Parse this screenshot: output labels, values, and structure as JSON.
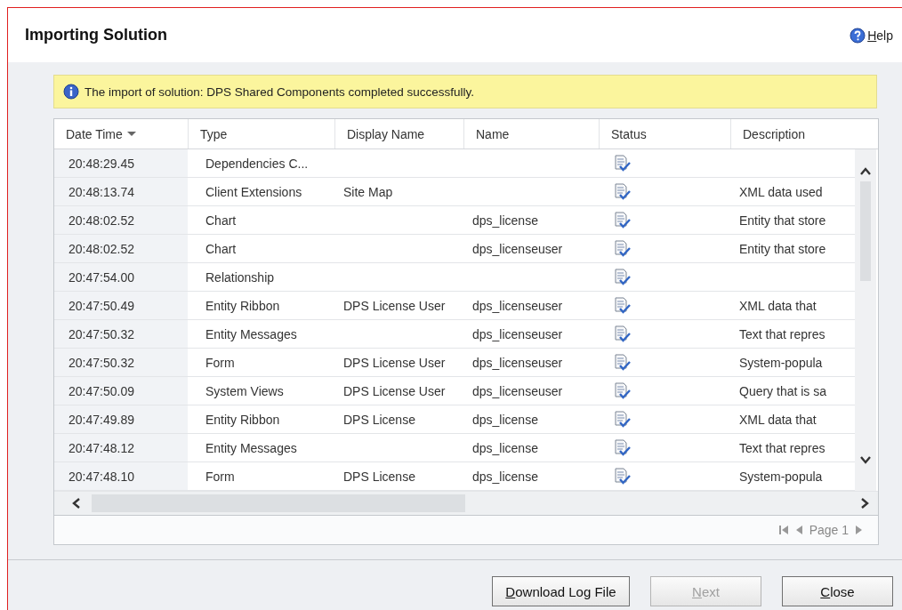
{
  "window": {
    "title": "Importing Solution",
    "help": "Help"
  },
  "banner": {
    "text": "The import of solution: DPS Shared Components completed successfully."
  },
  "table": {
    "columns": [
      {
        "label": "Date Time",
        "sorted": true
      },
      {
        "label": "Type",
        "sorted": false
      },
      {
        "label": "Display Name",
        "sorted": false
      },
      {
        "label": "Name",
        "sorted": false
      },
      {
        "label": "Status",
        "sorted": false
      },
      {
        "label": "Description",
        "sorted": false
      }
    ],
    "rows": [
      {
        "time": "20:48:29.45",
        "type": "Dependencies C...",
        "display_name": "",
        "name": "",
        "completed": true,
        "description": ""
      },
      {
        "time": "20:48:13.74",
        "type": "Client Extensions",
        "display_name": "Site Map",
        "name": "",
        "completed": true,
        "description": "XML data used"
      },
      {
        "time": "20:48:02.52",
        "type": "Chart",
        "display_name": "",
        "name": "dps_license",
        "completed": true,
        "description": "Entity that store"
      },
      {
        "time": "20:48:02.52",
        "type": "Chart",
        "display_name": "",
        "name": "dps_licenseuser",
        "completed": true,
        "description": "Entity that store"
      },
      {
        "time": "20:47:54.00",
        "type": "Relationship",
        "display_name": "",
        "name": "",
        "completed": true,
        "description": ""
      },
      {
        "time": "20:47:50.49",
        "type": "Entity Ribbon",
        "display_name": "DPS License User",
        "name": "dps_licenseuser",
        "completed": true,
        "description": "XML data that"
      },
      {
        "time": "20:47:50.32",
        "type": "Entity Messages",
        "display_name": "",
        "name": "dps_licenseuser",
        "completed": true,
        "description": "Text that repres"
      },
      {
        "time": "20:47:50.32",
        "type": "Form",
        "display_name": "DPS License User",
        "name": "dps_licenseuser",
        "completed": true,
        "description": "System-popula"
      },
      {
        "time": "20:47:50.09",
        "type": "System Views",
        "display_name": "DPS License User",
        "name": "dps_licenseuser",
        "completed": true,
        "description": "Query that is sa"
      },
      {
        "time": "20:47:49.89",
        "type": "Entity Ribbon",
        "display_name": "DPS License",
        "name": "dps_license",
        "completed": true,
        "description": "XML data that"
      },
      {
        "time": "20:47:48.12",
        "type": "Entity Messages",
        "display_name": "",
        "name": "dps_license",
        "completed": true,
        "description": "Text that repres"
      },
      {
        "time": "20:47:48.10",
        "type": "Form",
        "display_name": "DPS License",
        "name": "dps_license",
        "completed": true,
        "description": "System-popula"
      }
    ]
  },
  "pager": {
    "label": "Page 1"
  },
  "buttons": [
    {
      "label": "Download Log File",
      "disabled": false
    },
    {
      "label": "Next",
      "disabled": true
    },
    {
      "label": "Close",
      "disabled": false
    }
  ]
}
